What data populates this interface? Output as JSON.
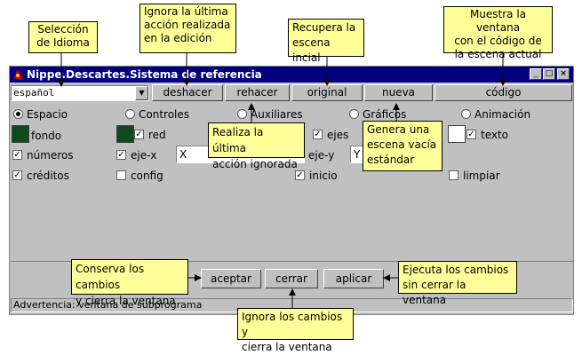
{
  "window": {
    "title": "Nippe.Descartes.Sistema de referencia"
  },
  "language": {
    "selected": "español"
  },
  "toolbar": {
    "undo": "deshacer",
    "redo": "rehacer",
    "original": "original",
    "new": "nueva",
    "code": "código"
  },
  "tabs": [
    {
      "label": "Espacio",
      "selected": true
    },
    {
      "label": "Controles",
      "selected": false
    },
    {
      "label": "Auxiliares",
      "selected": false
    },
    {
      "label": "Gráficos",
      "selected": false
    },
    {
      "label": "Animación",
      "selected": false
    }
  ],
  "options": {
    "fondo": "fondo",
    "red": "red",
    "ejes": "ejes",
    "texto": "texto",
    "numeros": "números",
    "ejex": "eje-x",
    "ejex_value": "X",
    "ejey": "eje-y",
    "ejey_value": "Y",
    "creditos": "créditos",
    "config": "config",
    "inicio": "inicio",
    "limpiar": "limpiar"
  },
  "colors": {
    "fondo": "#0f4a1e",
    "red": "#0f4a1e",
    "texto": "#ffffff",
    "titlebar": "#000080",
    "note": "#ffff99"
  },
  "buttons": {
    "accept": "aceptar",
    "close": "cerrar",
    "apply": "aplicar"
  },
  "status": "Advertencia: ventana de subprograma",
  "notes": {
    "language": "Selección\nde Idioma",
    "undo": "Ignora la última\nacción realizada\nen la edición",
    "original": "Recupera la\nescena incial",
    "code": "Muestra la ventana\ncon el código de\nla escena actual",
    "redo": "Realiza la última\nacción ignorada",
    "new": "Genera una\nescena vacía\nestándar",
    "accept": "Conserva los cambios\ny cierra la ventana",
    "apply": "Ejecuta los cambios\nsin cerrar la ventana",
    "close": "Ignora los cambios y\ncierra la ventana"
  }
}
